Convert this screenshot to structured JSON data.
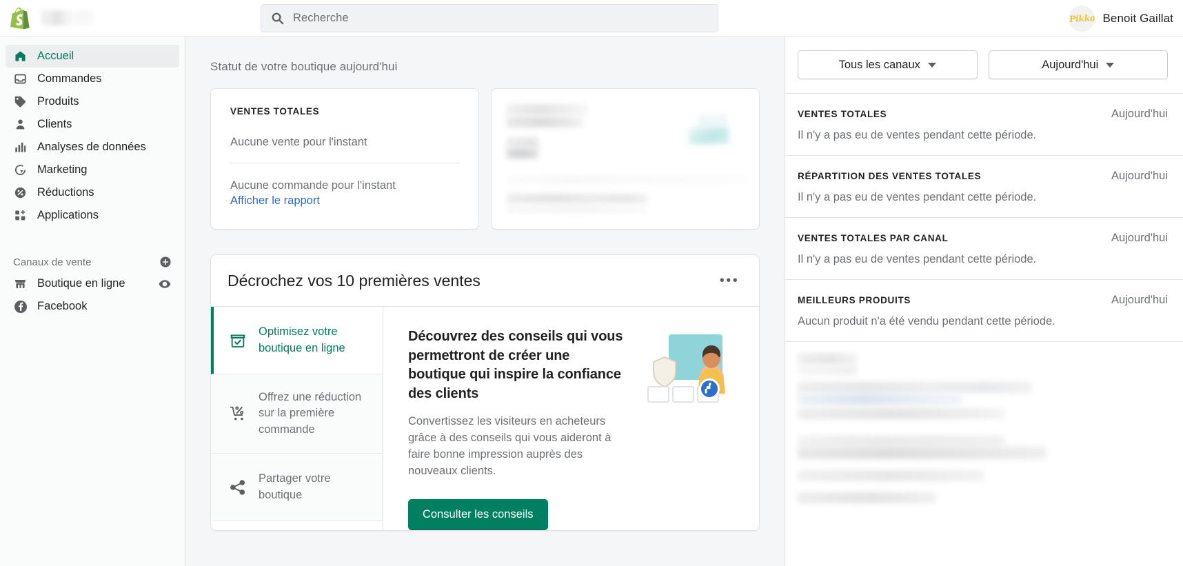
{
  "topbar": {
    "logo_name": "shopify-logo",
    "store_name_redacted": "",
    "search": {
      "placeholder": "Recherche",
      "value": "",
      "icon": "search-icon"
    },
    "user": {
      "name": "Benoit Gaillat",
      "avatar_text": "Pikka"
    }
  },
  "sidebar": {
    "items": [
      {
        "label": "Accueil",
        "icon": "home-icon",
        "active": true
      },
      {
        "label": "Commandes",
        "icon": "orders-inbox-icon",
        "active": false
      },
      {
        "label": "Produits",
        "icon": "tag-icon",
        "active": false
      },
      {
        "label": "Clients",
        "icon": "person-icon",
        "active": false
      },
      {
        "label": "Analyses de données",
        "icon": "bar-chart-icon",
        "active": false
      },
      {
        "label": "Marketing",
        "icon": "target-cursor-icon",
        "active": false
      },
      {
        "label": "Réductions",
        "icon": "percent-badge-icon",
        "active": false
      },
      {
        "label": "Applications",
        "icon": "apps-grid-icon",
        "active": false
      }
    ],
    "sales_channels": {
      "title": "Canaux de vente",
      "add_icon": "plus-circle-icon",
      "channels": [
        {
          "label": "Boutique en ligne",
          "icon": "storefront-icon",
          "action_icon": "eye-icon"
        },
        {
          "label": "Facebook",
          "icon": "facebook-icon",
          "action_icon": ""
        }
      ]
    }
  },
  "main": {
    "status_title": "Statut de votre boutique aujourd'hui",
    "sales_card": {
      "metric_label": "VENTES TOTALES",
      "no_sales": "Aucune vente pour l'instant",
      "no_orders": "Aucune commande pour l'instant",
      "report_link": "Afficher le rapport"
    },
    "blurred_card": {
      "name": "redacted-metrics-card"
    },
    "promo": {
      "title": "Décrochez vos 10 premières ventes",
      "overflow_icon": "ellipsis-icon",
      "tasks": [
        {
          "label": "Optimisez votre boutique en ligne",
          "icon": "store-check-icon",
          "active": true
        },
        {
          "label": "Offrez une réduction sur la première commande",
          "icon": "cart-percent-icon",
          "active": false
        },
        {
          "label": "Partager votre boutique",
          "icon": "share-icon",
          "active": false
        }
      ],
      "detail": {
        "heading": "Découvrez des conseils qui vous permettront de créer une boutique qui inspire la confiance des clients",
        "body": "Convertissez les visiteurs en acheteurs grâce à des conseils qui vous aideront à faire bonne impression auprès des nouveaux clients.",
        "cta": "Consulter les conseils"
      }
    }
  },
  "right_panel": {
    "filters": [
      {
        "label": "Tous les canaux",
        "icon": "chevron-down-icon"
      },
      {
        "label": "Aujourd'hui",
        "icon": "chevron-down-icon"
      }
    ],
    "sections": [
      {
        "title": "VENTES TOTALES",
        "date": "Aujourd'hui",
        "empty": "Il n'y a pas eu de ventes pendant cette période."
      },
      {
        "title": "RÉPARTITION DES VENTES TOTALES",
        "date": "Aujourd'hui",
        "empty": "Il n'y a pas eu de ventes pendant cette période."
      },
      {
        "title": "VENTES TOTALES PAR CANAL",
        "date": "Aujourd'hui",
        "empty": "Il n'y a pas eu de ventes pendant cette période."
      },
      {
        "title": "MEILLEURS PRODUITS",
        "date": "Aujourd'hui",
        "empty": "Aucun produit n'a été vendu pendant cette période."
      }
    ]
  },
  "colors": {
    "brand_green": "#008060",
    "active_green": "#007b5c",
    "link_blue": "#2c6ecb",
    "text_dark": "#202223",
    "text_subdued": "#6d7175",
    "page_bg": "#f4f6f8",
    "sidebar_bg": "#fafbfb",
    "border": "#e1e3e5",
    "avatar_yellow": "#f2c230"
  }
}
